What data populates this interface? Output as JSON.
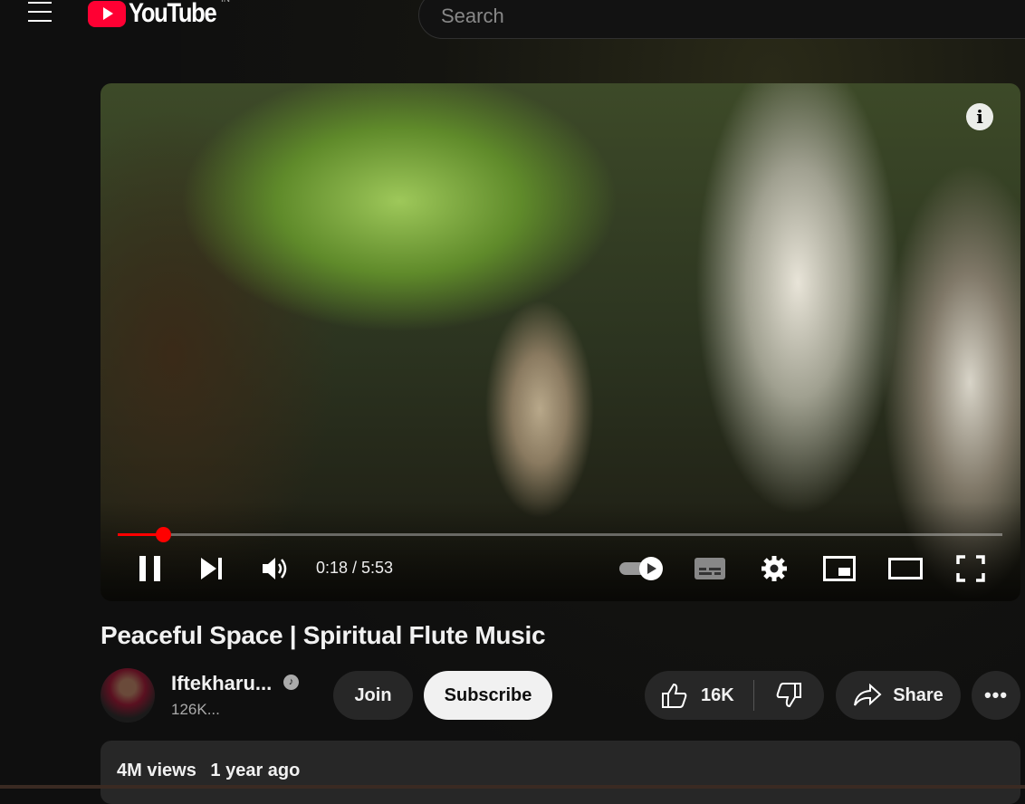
{
  "header": {
    "logo_text": "YouTube",
    "country": "IN",
    "search_placeholder": "Search"
  },
  "player": {
    "current_time": "0:18",
    "duration": "5:53",
    "time_display": "0:18 / 5:53",
    "progress_percent": 5.1,
    "autoplay_on": true
  },
  "video": {
    "title": "Peaceful Space | Spiritual Flute Music"
  },
  "channel": {
    "name": "Iftekharu...",
    "subscribers": "126K...",
    "join_label": "Join",
    "subscribe_label": "Subscribe"
  },
  "actions": {
    "likes": "16K",
    "share_label": "Share"
  },
  "description": {
    "views": "4M views",
    "age": "1 year ago"
  }
}
